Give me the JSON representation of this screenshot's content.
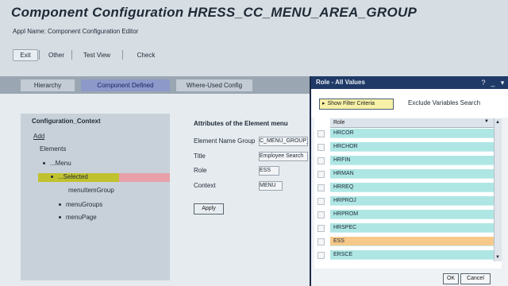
{
  "header": {
    "title": "Component Configuration HRESS_CC_MENU_AREA_GROUP",
    "app_name": "Appl Name: Component Configuration Editor"
  },
  "toolbar": {
    "exit_label": "Exit",
    "other_label": "Other",
    "view_label": "Test View",
    "check_label": "Check"
  },
  "tabs": [
    {
      "label": "Hierarchy"
    },
    {
      "label": "Component Defined"
    },
    {
      "label": "Where-Used Config"
    }
  ],
  "tree": {
    "root_label": "Configuration_Context",
    "row1": "Add",
    "row2": "Elements",
    "nodes": [
      {
        "label": "...Menu"
      },
      {
        "label": "...Selected"
      },
      {
        "label": "menuItemGroup"
      },
      {
        "label": "menuGroups"
      },
      {
        "label": "menuPage"
      }
    ]
  },
  "attributes": {
    "heading": "Attributes of the Element menu",
    "fields": [
      {
        "label": "Element Name Group",
        "value": "C_MENU_GROUP_ID"
      },
      {
        "label": "Title",
        "value": "Employee Search"
      },
      {
        "label": "Role",
        "value": "ESS"
      },
      {
        "label": "Context",
        "value": "MENU"
      }
    ],
    "apply_label": "Apply"
  },
  "popup": {
    "title": "Role - All Values",
    "show_filter_label": "Show Filter Criteria",
    "exclude_label": "Exclude Variables Search",
    "column_header": "Role",
    "rows": [
      "HRCOR",
      "HRCHOR",
      "HRFIN",
      "HRMAN",
      "HRREQ",
      "HRPROJ",
      "HRPROM",
      "HRSPEC",
      "ESS",
      "ERSCE"
    ],
    "selected_index": 8,
    "ok_label": "OK",
    "cancel_label": "Cancel"
  },
  "colors": {
    "title_bar": "#1f3a66",
    "list_row": "#aee6e4",
    "list_row_selected": "#f6c98a",
    "tree_selection": "#c0c12f",
    "active_tab": "#8c99c9"
  }
}
